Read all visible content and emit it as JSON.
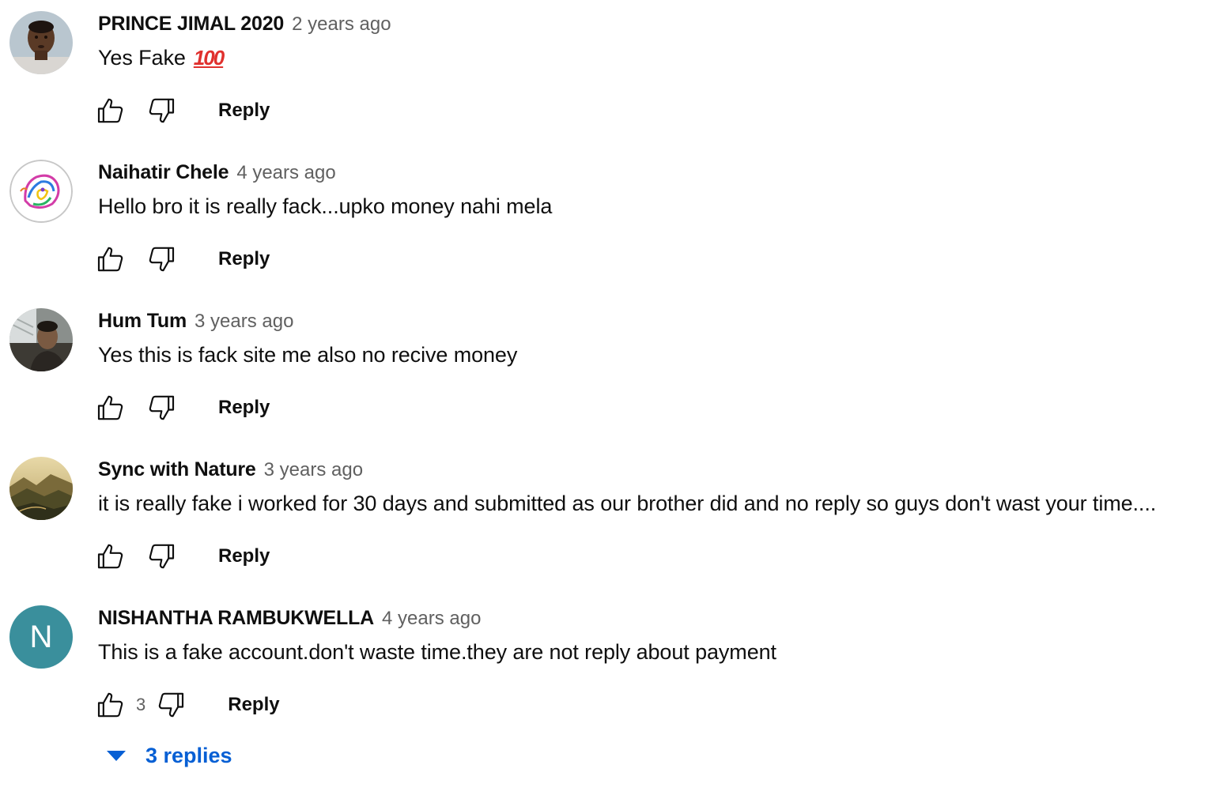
{
  "comments": [
    {
      "author": "PRINCE JIMAL 2020",
      "time": "2 years ago",
      "text": "Yes Fake",
      "emoji": "💯",
      "reply_label": "Reply"
    },
    {
      "author": "Naihatir Chele",
      "time": "4 years ago",
      "text": "Hello bro it is really fack...upko money nahi mela",
      "reply_label": "Reply"
    },
    {
      "author": "Hum Tum",
      "time": "3 years ago",
      "text": "Yes this is fack site me also no recive money",
      "reply_label": "Reply"
    },
    {
      "author": "Sync with Nature",
      "time": "3 years ago",
      "text": "it is really fake i worked for 30 days and submitted as our brother did and no reply so guys don't wast your time....",
      "reply_label": "Reply"
    },
    {
      "author": "NISHANTHA RAMBUKWELLA",
      "time": "4 years ago",
      "text": "This is a fake account.don't waste time.they are not reply about payment",
      "like_count": "3",
      "reply_label": "Reply",
      "avatar_letter": "N",
      "replies_label": "3 replies"
    }
  ],
  "colors": {
    "link_blue": "#065fd4",
    "secondary_text": "#606060",
    "avatar_teal": "#3a8f9c"
  },
  "icons": {
    "like": "thumb-up-icon",
    "dislike": "thumb-down-icon",
    "expand": "caret-down-icon"
  }
}
